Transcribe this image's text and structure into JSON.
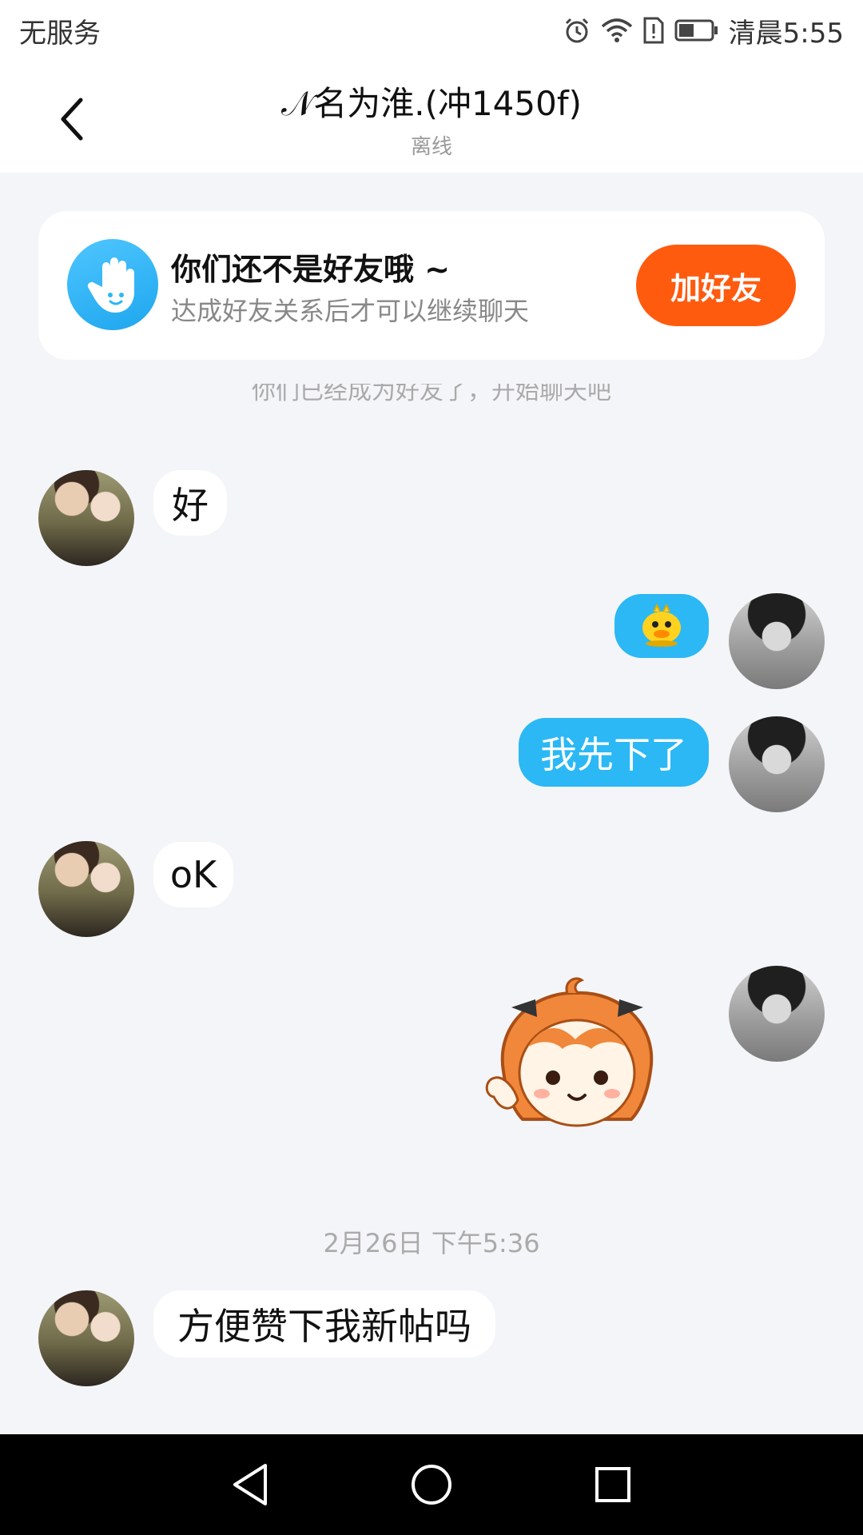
{
  "status_bar": {
    "carrier": "无服务",
    "time": "清晨5:55"
  },
  "header": {
    "title": "𝒩名为淮.(冲1450f)",
    "subtitle": "离线"
  },
  "friend_prompt": {
    "title": "你们还不是好友哦 ~",
    "subtitle": "达成好友关系后才可以继续聊天",
    "button": "加好友"
  },
  "system_message": "你们已经成为好友了，开始聊天吧",
  "messages": [
    {
      "side": "left",
      "text": "好"
    },
    {
      "side": "right",
      "type": "emoji",
      "icon": "duck-emoji-icon"
    },
    {
      "side": "right",
      "text": "我先下了"
    },
    {
      "side": "left",
      "text": "oK"
    },
    {
      "side": "right",
      "type": "sticker",
      "icon": "orange-hair-girl-sticker"
    }
  ],
  "timestamp": "2月26日 下午5:36",
  "last_message": {
    "side": "left",
    "text": "方便赞下我新帖吗"
  },
  "colors": {
    "accent_blue": "#2bb8f5",
    "add_friend_orange": "#ff5b0f",
    "background": "#f4f5f8"
  }
}
